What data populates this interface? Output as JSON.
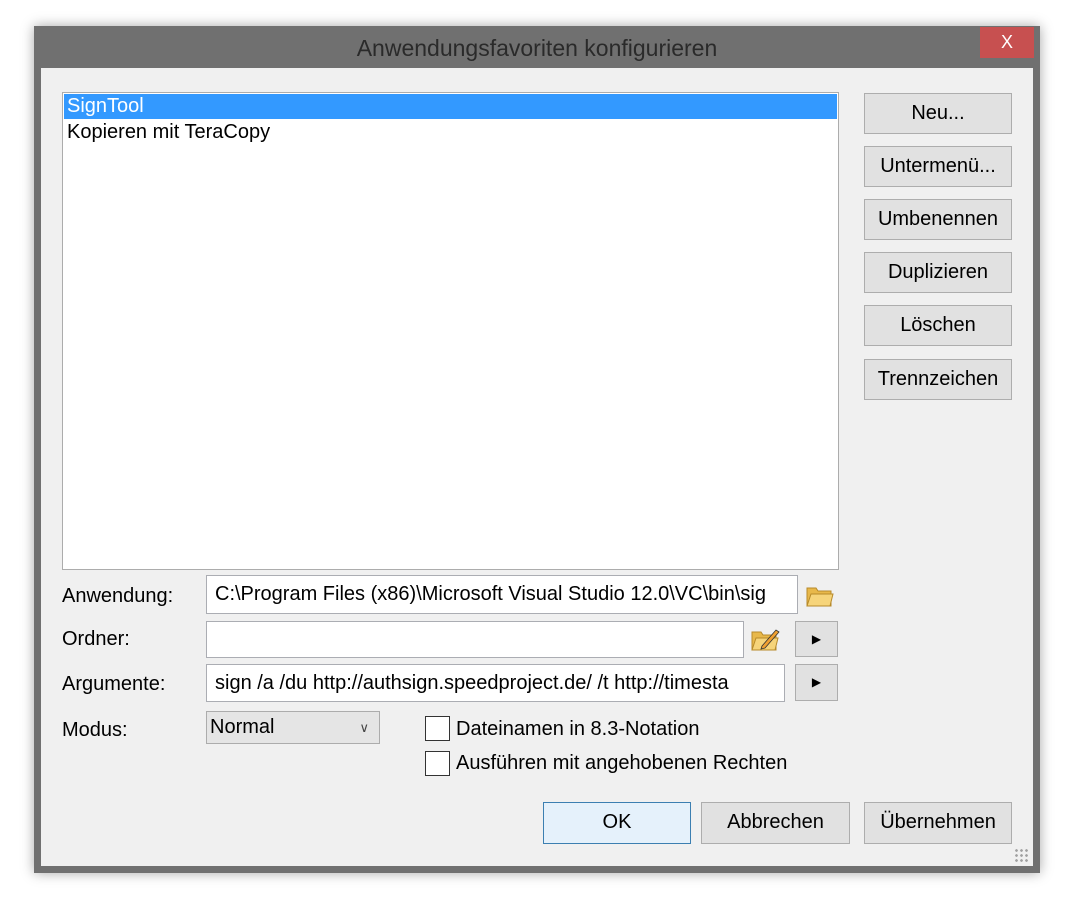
{
  "window": {
    "title": "Anwendungsfavoriten konfigurieren",
    "close": "X"
  },
  "list": {
    "items": [
      {
        "label": "SignTool",
        "selected": true
      },
      {
        "label": "Kopieren mit TeraCopy",
        "selected": false
      }
    ]
  },
  "side_buttons": {
    "new": "Neu...",
    "submenu": "Untermenü...",
    "rename": "Umbenennen",
    "duplicate": "Duplizieren",
    "delete": "Löschen",
    "separator": "Trennzeichen"
  },
  "form": {
    "application_label": "Anwendung:",
    "application_value": "C:\\Program Files (x86)\\Microsoft Visual Studio 12.0\\VC\\bin\\sig",
    "folder_label": "Ordner:",
    "folder_value": "",
    "arguments_label": "Argumente:",
    "arguments_value": "sign /a /du http://authsign.speedproject.de/ /t http://timesta",
    "mode_label": "Modus:",
    "mode_value": "Normal",
    "cb_83": "Dateinamen in 8.3-Notation",
    "cb_83_checked": false,
    "cb_elevated": "Ausführen mit angehobenen Rechten",
    "cb_elevated_checked": false
  },
  "footer": {
    "ok": "OK",
    "cancel": "Abbrechen",
    "apply": "Übernehmen"
  },
  "colors": {
    "selection": "#3399ff",
    "close": "#c75050",
    "titlebar": "#707070"
  }
}
